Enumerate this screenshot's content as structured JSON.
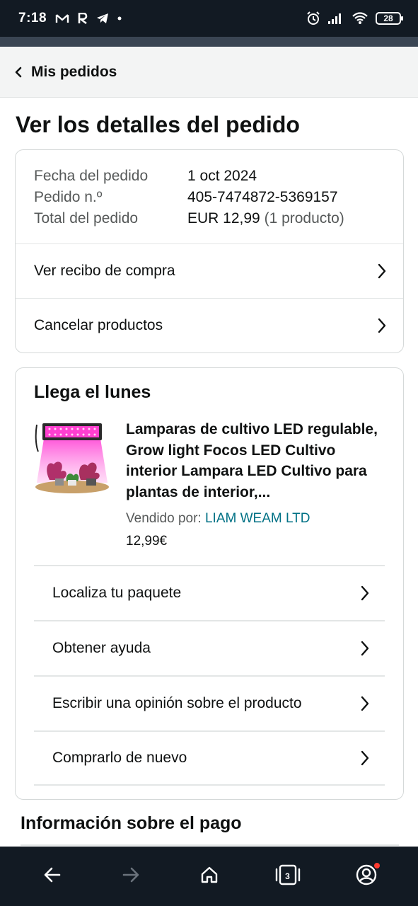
{
  "status_bar": {
    "time": "7:18",
    "left_icons": [
      "gmail-icon",
      "r-app-icon",
      "telegram-icon",
      "dot-icon"
    ],
    "right_icons": [
      "alarm-icon",
      "signal-icon",
      "wifi-icon"
    ],
    "battery": "28"
  },
  "nav": {
    "back_label": "Mis pedidos"
  },
  "page": {
    "title": "Ver los detalles del pedido"
  },
  "summary": {
    "rows": [
      {
        "label": "Fecha del pedido",
        "value": "1 oct 2024",
        "extra": ""
      },
      {
        "label": "Pedido n.º",
        "value": "405-7474872-5369157",
        "extra": ""
      },
      {
        "label": "Total del pedido",
        "value": "EUR 12,99",
        "extra": "(1 producto)"
      }
    ],
    "links": [
      "Ver recibo de compra",
      "Cancelar productos"
    ]
  },
  "shipment": {
    "heading": "Llega el lunes",
    "product": {
      "title": "Lamparas de cultivo LED regulable, Grow light Focos LED Cultivo interior Lampara LED Cultivo para plantas de interior,...",
      "seller_prefix": "Vendido por:",
      "seller_name": "LIAM WEAM LTD",
      "price": "12,99€"
    },
    "actions": [
      "Localiza tu paquete",
      "Obtener ayuda",
      "Escribir una opinión sobre el producto",
      "Comprarlo de nuevo"
    ]
  },
  "payment": {
    "title": "Información sobre el pago"
  },
  "bottom_bar": {
    "tabs_count": "3",
    "buttons": [
      "back-arrow-icon",
      "forward-arrow-icon",
      "home-icon",
      "tabs-icon",
      "account-icon"
    ]
  },
  "colors": {
    "link": "#007185",
    "muted": "#565959",
    "text": "#0f1111",
    "system_bar": "#121a23",
    "notification": "#ff3b30"
  }
}
